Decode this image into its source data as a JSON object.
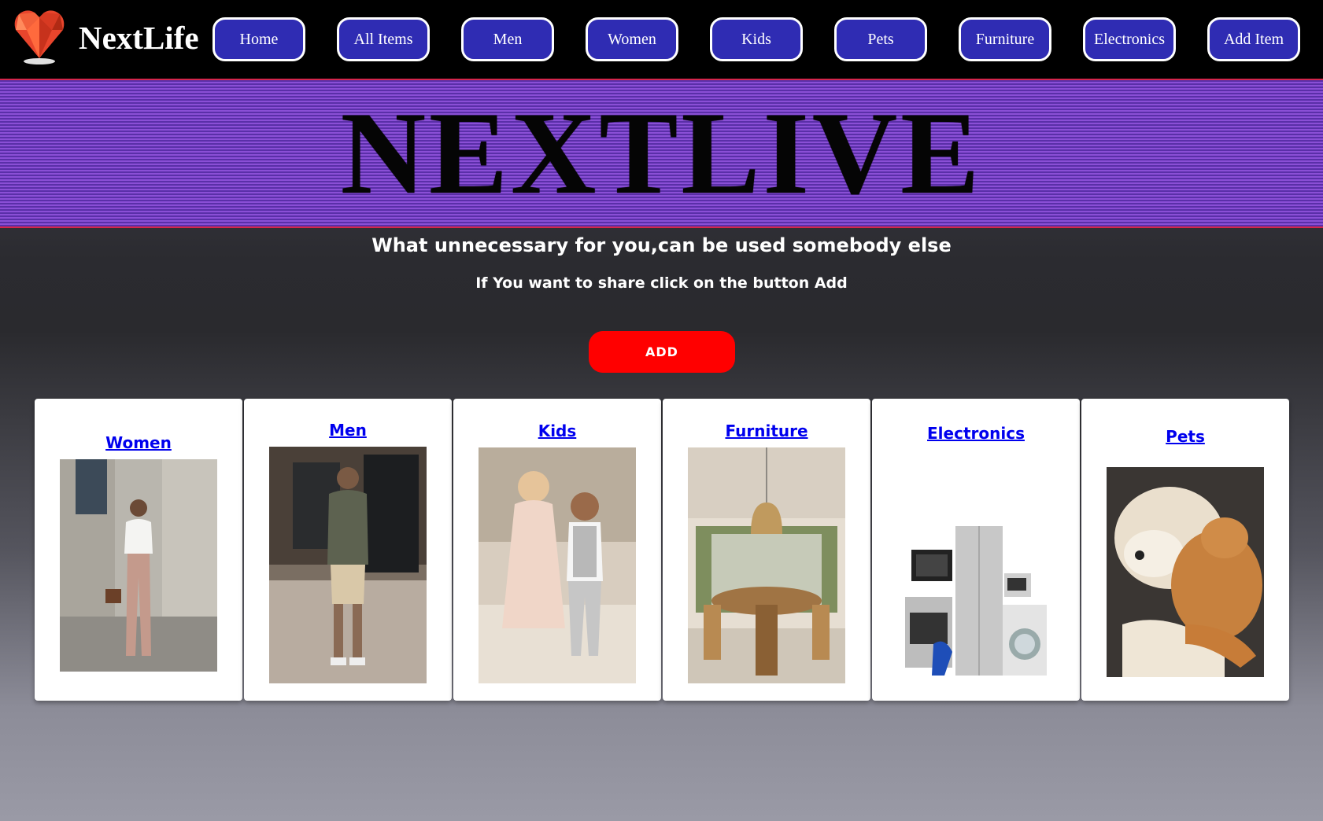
{
  "brand": {
    "name": "NextLife",
    "logo_icon": "heart-gem-icon"
  },
  "nav": {
    "items": [
      {
        "label": "Home"
      },
      {
        "label": "All Items"
      },
      {
        "label": "Men"
      },
      {
        "label": "Women"
      },
      {
        "label": "Kids"
      },
      {
        "label": "Pets"
      },
      {
        "label": "Furniture"
      },
      {
        "label": "Electronics"
      },
      {
        "label": "Add Item"
      }
    ]
  },
  "hero": {
    "title": "NEXTLIVE"
  },
  "intro": {
    "tagline": "What unnecessary for you,can be used somebody else",
    "subline": "If You want to share click on the button Add",
    "add_button": "ADD"
  },
  "categories": [
    {
      "label": "Women"
    },
    {
      "label": "Men"
    },
    {
      "label": "Kids"
    },
    {
      "label": "Furniture"
    },
    {
      "label": "Electronics"
    },
    {
      "label": "Pets"
    }
  ],
  "colors": {
    "nav_button_bg": "#2f2cb3",
    "add_button_bg": "#ff0000",
    "hero_stripes": "#7a44c8",
    "link": "#0000ee"
  }
}
